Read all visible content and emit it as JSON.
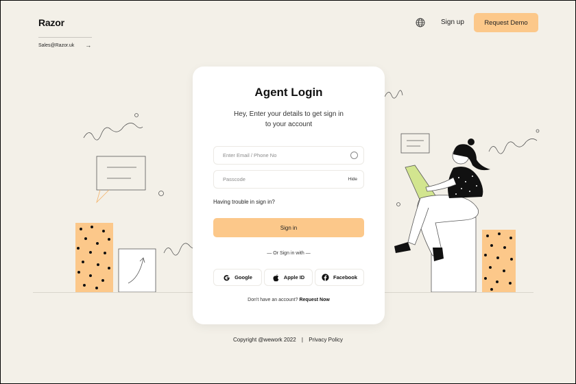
{
  "brand": {
    "name": "Razor",
    "email": "Sales@Razor.uk"
  },
  "nav": {
    "signup": "Sign up",
    "demo": "Request Demo"
  },
  "login": {
    "title": "Agent Login",
    "subtitle_line1": "Hey, Enter your details to get sign in",
    "subtitle_line2": "to your account",
    "email_placeholder": "Enter Email / Phone No",
    "password_placeholder": "Passcode",
    "hide_label": "Hide",
    "trouble": "Having trouble in sign in?",
    "signin_button": "Sign in",
    "or_text": "— Or Sign in with —",
    "social": {
      "google": "Google",
      "apple": "Apple ID",
      "facebook": "Facebook"
    },
    "no_account": "Don't have an account?",
    "request_now": "Request Now"
  },
  "footer": {
    "copyright": "Copyright @wework 2022",
    "separator": "|",
    "privacy": "Privacy Policy"
  },
  "colors": {
    "background": "#f3f0e8",
    "accent": "#fcc88a",
    "card": "#ffffff"
  },
  "icons": [
    "globe-icon",
    "arrow-right-icon",
    "circle-icon",
    "google-icon",
    "apple-icon",
    "facebook-icon"
  ]
}
